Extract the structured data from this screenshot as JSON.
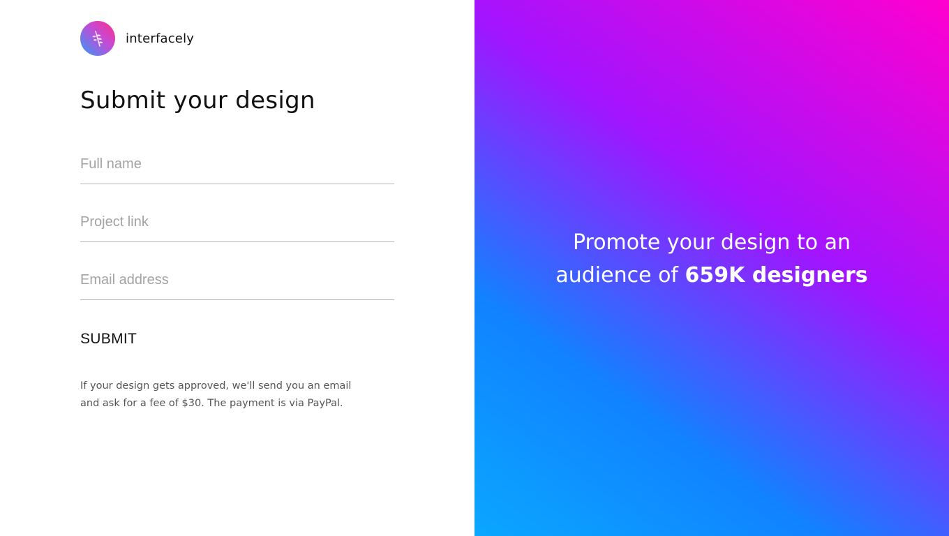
{
  "brand": {
    "name": "interfacely",
    "logo_icon": "wheat-icon"
  },
  "form": {
    "title": "Submit your design",
    "fields": [
      {
        "placeholder": "Full name",
        "value": ""
      },
      {
        "placeholder": "Project link",
        "value": ""
      },
      {
        "placeholder": "Email address",
        "value": ""
      }
    ],
    "submit_label": "SUBMIT",
    "note_line1": "If your design gets approved, we'll send you an email",
    "note_line2": "and ask for a fee of $30. The payment is via PayPal."
  },
  "promo": {
    "line1": "Promote your design to an",
    "line2_prefix": "audience of ",
    "line2_highlight": "659K designers"
  },
  "colors": {
    "gradient_start": "#0aa7ff",
    "gradient_mid": "#a214ff",
    "gradient_end": "#ff00cf",
    "progress_accent": "#1e88e5"
  }
}
